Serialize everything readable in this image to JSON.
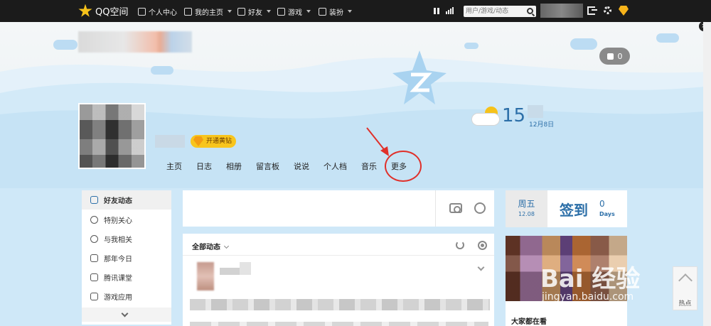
{
  "topbar": {
    "logo_text": "QQ空间",
    "nav": [
      "个人中心",
      "我的主页",
      "好友",
      "游戏",
      "装扮"
    ],
    "search_placeholder": "用户/游戏/动态"
  },
  "banner": {
    "like_count": "0",
    "temperature": "15",
    "date": "12月8日",
    "vip_label": "开通黄钻",
    "tabs": [
      "主页",
      "日志",
      "相册",
      "留言板",
      "说说",
      "个人档",
      "音乐",
      "更多"
    ]
  },
  "sidebar": {
    "items": [
      "好友动态",
      "特别关心",
      "与我相关",
      "那年今日",
      "腾讯课堂",
      "游戏应用"
    ]
  },
  "feed": {
    "title": "全部动态"
  },
  "checkin": {
    "weekday": "周五",
    "date": "12.08",
    "label": "签到",
    "days": "0",
    "days_label": "Days"
  },
  "photo_card": {
    "caption": "大家都在看"
  },
  "hot_button": {
    "label": "热点"
  },
  "watermark": {
    "text": "Bai 经验",
    "sub": "jingyan.baidu.com"
  },
  "colors": {
    "accent": "#2c6fa8",
    "vip": "#f8c51d",
    "annotation": "#e0302a"
  }
}
